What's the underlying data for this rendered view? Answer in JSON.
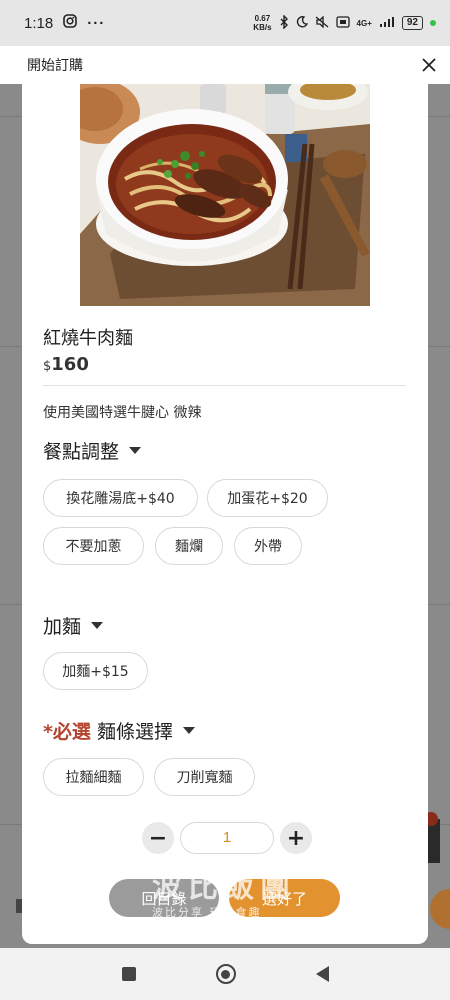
{
  "status_bar": {
    "time": "1:18",
    "net_speed_value": "0.67",
    "net_speed_unit": "KB/s",
    "network": "4G+",
    "battery": "92"
  },
  "app_bar": {
    "title": "開始訂購",
    "close_icon": "close-icon"
  },
  "product": {
    "name": "紅燒牛肉麵",
    "currency": "$",
    "price": "160",
    "description": "使用美國特選牛腱心 微辣"
  },
  "sections": {
    "meal_adjust": {
      "title": "餐點調整",
      "options": [
        "換花雕湯底+$40",
        "加蛋花+$20",
        "不要加蔥",
        "麵爛",
        "外帶"
      ]
    },
    "add_noodle": {
      "title": "加麵",
      "options": [
        "加麵+$15"
      ]
    },
    "noodle_choice": {
      "required_label": "*必選",
      "title": "麵條選擇",
      "options": [
        "拉麵細麵",
        "刀削寬麵"
      ]
    }
  },
  "quantity": {
    "minus": "−",
    "value": "1",
    "plus": "+"
  },
  "actions": {
    "back_label": "回目錄",
    "confirm_label": "選好了"
  },
  "watermark": {
    "main": "波比飯團",
    "sub": "波比分享 玩樂食趣"
  },
  "colors": {
    "accent_orange": "#e2922f",
    "required_red": "#b4432f",
    "quantity_text": "#e0891f"
  }
}
